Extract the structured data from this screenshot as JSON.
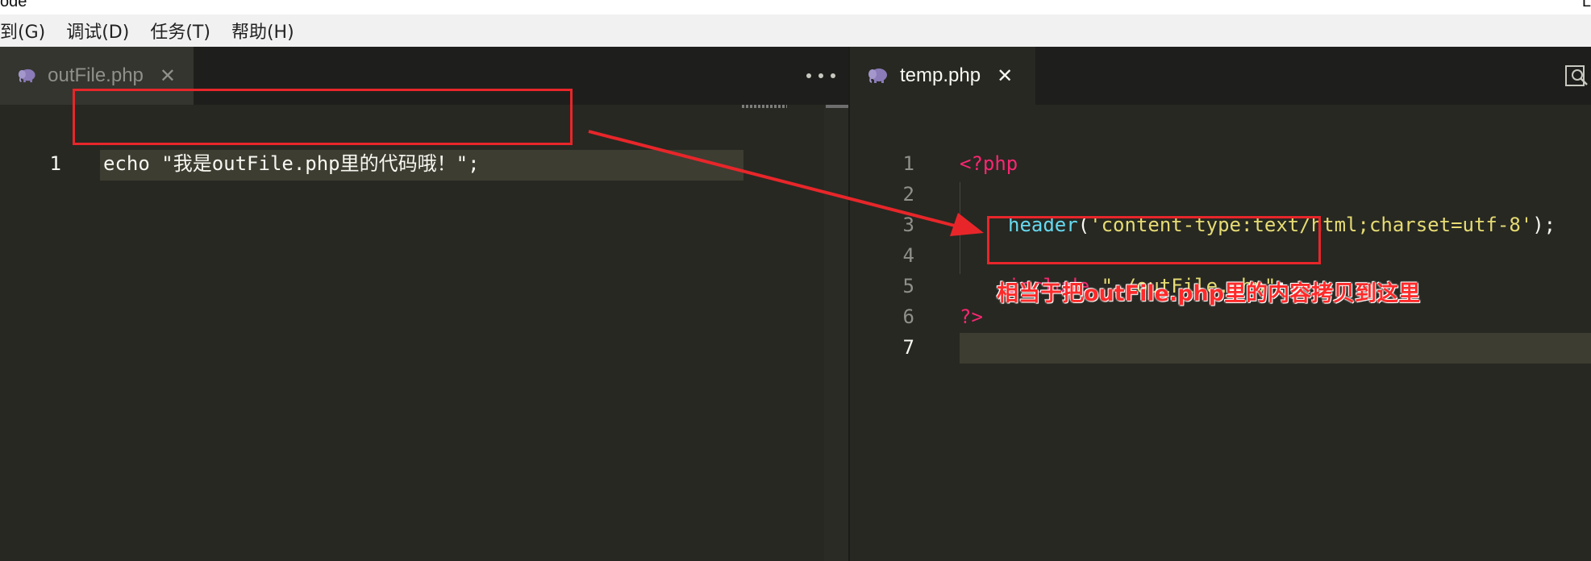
{
  "window": {
    "title_fragment": "ode",
    "corner_glyph": "L"
  },
  "menubar": {
    "items": [
      {
        "label": "到(G)"
      },
      {
        "label": "调试(D)"
      },
      {
        "label": "任务(T)"
      },
      {
        "label": "帮助(H)"
      }
    ]
  },
  "left_pane": {
    "tab": {
      "label": "outFile.php",
      "close": "✕",
      "icon": "php-elephant-icon"
    },
    "more_icon": "more-horizontal-icon",
    "lines": [
      {
        "num": "1",
        "text": "echo \"我是outFile.php里的代码哦！\";"
      }
    ]
  },
  "right_pane": {
    "tab": {
      "label": "temp.php",
      "close": "✕",
      "icon": "php-elephant-icon"
    },
    "split_icon": "split-editor-icon",
    "lines": [
      {
        "num": "1",
        "tokens": [
          {
            "t": "<?php",
            "c": "kw-pink"
          }
        ]
      },
      {
        "num": "2",
        "tokens": []
      },
      {
        "num": "3",
        "tokens": [
          {
            "t": "header",
            "c": "fn-cyan"
          },
          {
            "t": "(",
            "c": "plain"
          },
          {
            "t": "'content-type:text/html;charset=utf-8'",
            "c": "str-yellow"
          },
          {
            "t": ");",
            "c": "plain"
          }
        ]
      },
      {
        "num": "4",
        "tokens": []
      },
      {
        "num": "5",
        "tokens": [
          {
            "t": "include",
            "c": "kw-pink"
          },
          {
            "t": " ",
            "c": "plain"
          },
          {
            "t": "\"./outFile.php\"",
            "c": "str-yellow"
          },
          {
            "t": ";",
            "c": "plain"
          }
        ]
      },
      {
        "num": "6",
        "tokens": [
          {
            "t": "?>",
            "c": "kw-pink"
          }
        ]
      },
      {
        "num": "7",
        "tokens": []
      }
    ]
  },
  "annotation": {
    "text": "相当于把outFile.php里的内容拷贝到这里",
    "color": "#e8262a"
  },
  "colors": {
    "editor_bg": "#272822",
    "keyword": "#f92672",
    "string": "#e6db74",
    "function": "#66d9ef",
    "text": "#f8f8f2"
  }
}
